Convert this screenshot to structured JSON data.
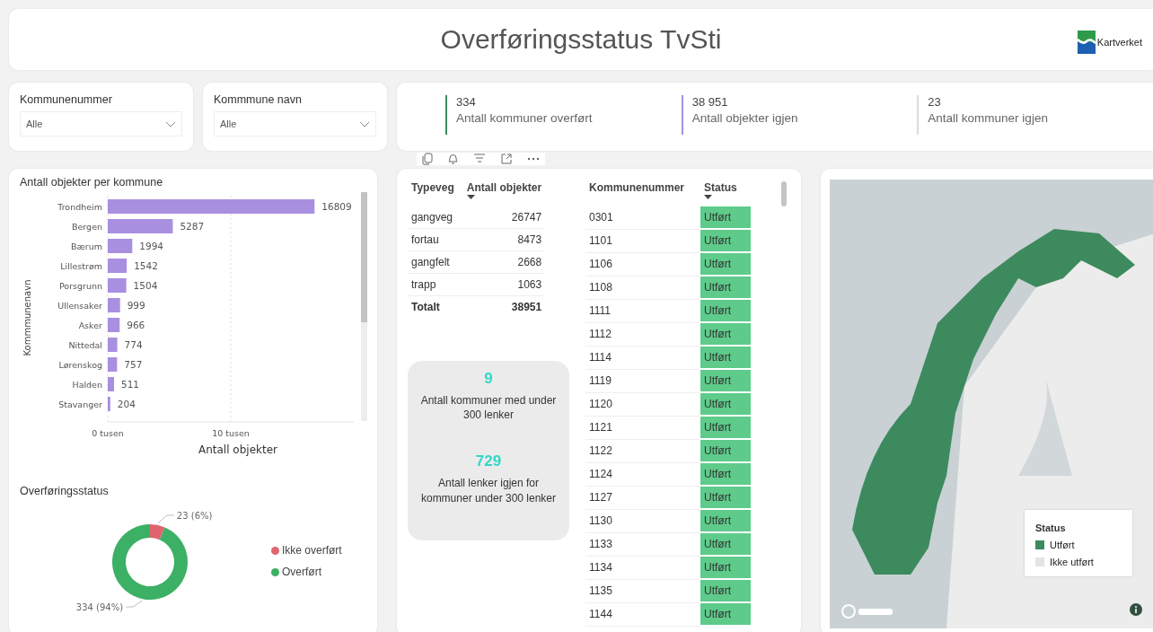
{
  "header": {
    "title": "Overføringsstatus TvSti",
    "logo_text": "Kartverket"
  },
  "filters": [
    {
      "label": "Kommunenummer",
      "value": "Alle"
    },
    {
      "label": "Kommmune navn",
      "value": "Alle"
    }
  ],
  "kpis": [
    {
      "value": "334",
      "label": "Antall kommuner overført",
      "color": "#3c8c5c"
    },
    {
      "value": "38 951",
      "label": "Antall objekter igjen",
      "color": "#a58fe0"
    },
    {
      "value": "23",
      "label": "Antall kommuner igjen",
      "color": "#dddddd"
    }
  ],
  "bar_panel": {
    "title": "Antall objekter per kommune",
    "chart_data": {
      "type": "bar",
      "orientation": "horizontal",
      "xlabel": "Antall objekter",
      "ylabel": "Kommmunenavn",
      "categories": [
        "Trondheim",
        "Bergen",
        "Bærum",
        "Lillestrøm",
        "Porsgrunn",
        "Ullensaker",
        "Asker",
        "Nittedal",
        "Lørenskog",
        "Halden",
        "Stavanger"
      ],
      "series": [
        {
          "color": "#a98fe0",
          "values": [
            16.809,
            5.287,
            1.994,
            1.542,
            1.504,
            0.999,
            0.966,
            0.774,
            0.757,
            0.511,
            0.204
          ]
        }
      ],
      "xlim": [
        0,
        20
      ],
      "xticks": [
        {
          "value": 0,
          "label": "0 tusen"
        },
        {
          "value": 10,
          "label": "10 tusen"
        }
      ],
      "value_labels": [
        "16809",
        "5287",
        "1994",
        "1542",
        "1504",
        "999",
        "966",
        "774",
        "757",
        "511",
        "204"
      ]
    }
  },
  "donut_panel": {
    "title": "Overføringsstatus",
    "chart_data": {
      "type": "donut",
      "categories": [
        "Ikke overført",
        "Overført"
      ],
      "values": [
        23,
        334
      ],
      "value_labels": [
        "23 (6%)",
        "334 (94%)"
      ]
    },
    "legend": [
      {
        "color": "#e06470"
      },
      {
        "color": "#3cb065"
      }
    ]
  },
  "type_table": {
    "columns": [
      {
        "label": "Typeveg",
        "sorted": false
      },
      {
        "label": "Antall objekter",
        "sorted": true
      }
    ],
    "rows": [
      [
        "gangveg",
        "26747"
      ],
      [
        "fortau",
        "8473"
      ],
      [
        "gangfelt",
        "2668"
      ],
      [
        "trapp",
        "1063"
      ]
    ],
    "total": [
      "Totalt",
      "38951"
    ]
  },
  "summary_card": {
    "items": [
      {
        "value": "9",
        "label": "Antall kommuner med under 300 lenker"
      },
      {
        "value": "729",
        "label": "Antall lenker igjen for kommuner under 300 lenker"
      }
    ]
  },
  "status_table": {
    "columns": [
      {
        "label": "Kommunenummer",
        "sorted": false
      },
      {
        "label": "Status",
        "sorted": true
      }
    ],
    "rows": [
      {
        "number": "0301",
        "status": "Utført",
        "done": true
      },
      {
        "number": "1101",
        "status": "Utført",
        "done": true
      },
      {
        "number": "1106",
        "status": "Utført",
        "done": true
      },
      {
        "number": "1108",
        "status": "Utført",
        "done": true
      },
      {
        "number": "1111",
        "status": "Utført",
        "done": true
      },
      {
        "number": "1112",
        "status": "Utført",
        "done": true
      },
      {
        "number": "1114",
        "status": "Utført",
        "done": true
      },
      {
        "number": "1119",
        "status": "Utført",
        "done": true
      },
      {
        "number": "1120",
        "status": "Utført",
        "done": true
      },
      {
        "number": "1121",
        "status": "Utført",
        "done": true
      },
      {
        "number": "1122",
        "status": "Utført",
        "done": true
      },
      {
        "number": "1124",
        "status": "Utført",
        "done": true
      },
      {
        "number": "1127",
        "status": "Utført",
        "done": true
      },
      {
        "number": "1130",
        "status": "Utført",
        "done": true
      },
      {
        "number": "1133",
        "status": "Utført",
        "done": true
      },
      {
        "number": "1134",
        "status": "Utført",
        "done": true
      },
      {
        "number": "1135",
        "status": "Utført",
        "done": true
      },
      {
        "number": "1144",
        "status": "Utført",
        "done": true
      }
    ]
  },
  "map": {
    "legend": {
      "title": "Status",
      "items": [
        {
          "label": "Utført",
          "color": "#3d8a5e"
        },
        {
          "label": "Ikke utført",
          "color": "#e4e4e4"
        }
      ]
    }
  }
}
